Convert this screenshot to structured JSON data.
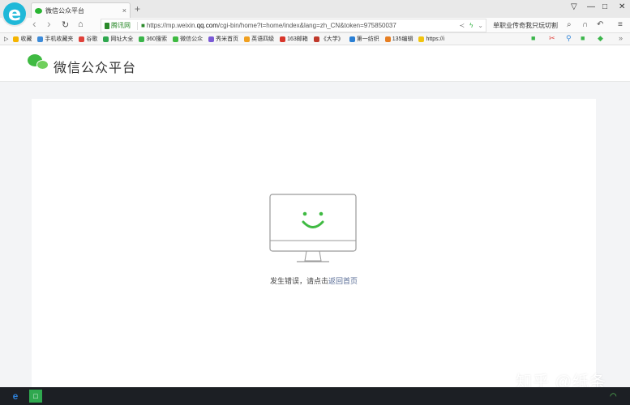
{
  "browser": {
    "logo_letter": "e",
    "tab": {
      "title": "微信公众平台",
      "close": "×"
    },
    "new_tab": "+",
    "window_controls": [
      "▽",
      "—",
      "□",
      "✕"
    ],
    "nav": {
      "back": "‹",
      "forward": "›",
      "reload": "↻",
      "home": "⌂"
    },
    "address": {
      "site_tag": "腾讯网",
      "lock": "🔒",
      "url_prefix": "https://mp.weixin.",
      "url_domain": "qq.com",
      "url_path": "/cgi-bin/home?t=home/index&lang=zh_CN&token=975850037"
    },
    "search_text": "单职业传奇我只玩切割",
    "bookmarks": [
      {
        "label": "收藏",
        "color": "#f5b400"
      },
      {
        "label": "手机收藏夹",
        "color": "#3c8bd9"
      },
      {
        "label": "谷歌",
        "color": "#e0413a"
      },
      {
        "label": "网址大全",
        "color": "#2fa84f"
      },
      {
        "label": "360搜索",
        "color": "#3ab54a"
      },
      {
        "label": "微信公众",
        "color": "#3fba42"
      },
      {
        "label": "秀米首页",
        "color": "#7b5ad6"
      },
      {
        "label": "英语四级",
        "color": "#f0a020"
      },
      {
        "label": "163邮箱",
        "color": "#d8352a"
      },
      {
        "label": "《大学》",
        "color": "#c0392b"
      },
      {
        "label": "第一纺织",
        "color": "#2a7fd4"
      },
      {
        "label": "135编辑",
        "color": "#e67e22"
      },
      {
        "label": "https://i",
        "color": "#f1c40f"
      }
    ]
  },
  "page": {
    "brand": "微信公众平台",
    "error_text": "发生错误，请点击",
    "error_link": "返回首页"
  },
  "watermark": "知乎 @纸条",
  "colors": {
    "accent": "#3fba42",
    "link": "#576b95"
  }
}
